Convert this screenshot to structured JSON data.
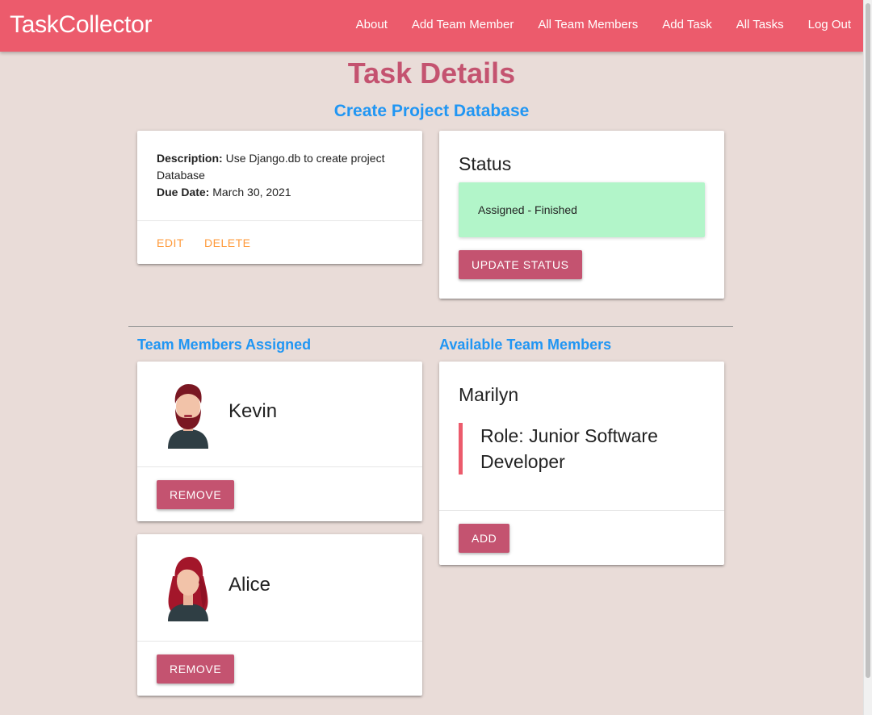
{
  "app": {
    "brand": "TaskCollector"
  },
  "nav": {
    "items": [
      {
        "label": "About"
      },
      {
        "label": "Add Team Member"
      },
      {
        "label": "All Team Members"
      },
      {
        "label": "Add Task"
      },
      {
        "label": "All Tasks"
      },
      {
        "label": "Log Out"
      }
    ]
  },
  "page": {
    "title": "Task Details",
    "task_name": "Create Project Database"
  },
  "details": {
    "description_label": "Description:",
    "description_value": " Use Django.db to create project Database",
    "due_label": "Due Date:",
    "due_value": " March 30, 2021",
    "edit_label": "EDIT",
    "delete_label": "DELETE"
  },
  "status": {
    "heading": "Status",
    "value": "Assigned - Finished",
    "update_label": "UPDATE STATUS"
  },
  "assigned": {
    "heading": "Team Members Assigned",
    "members": [
      {
        "name": "Kevin",
        "remove_label": "REMOVE"
      },
      {
        "name": "Alice",
        "remove_label": "REMOVE"
      }
    ]
  },
  "available": {
    "heading": "Available Team Members",
    "members": [
      {
        "name": "Marilyn",
        "role": "Role: Junior Software Developer",
        "add_label": "ADD"
      }
    ]
  },
  "colors": {
    "navbar": "#ec5b6c",
    "accent": "#c45370",
    "link_blue": "#2196f3",
    "link_orange": "#ff9b3c",
    "status_bg": "#b2f5c9",
    "page_bg": "#e9dcd8"
  }
}
